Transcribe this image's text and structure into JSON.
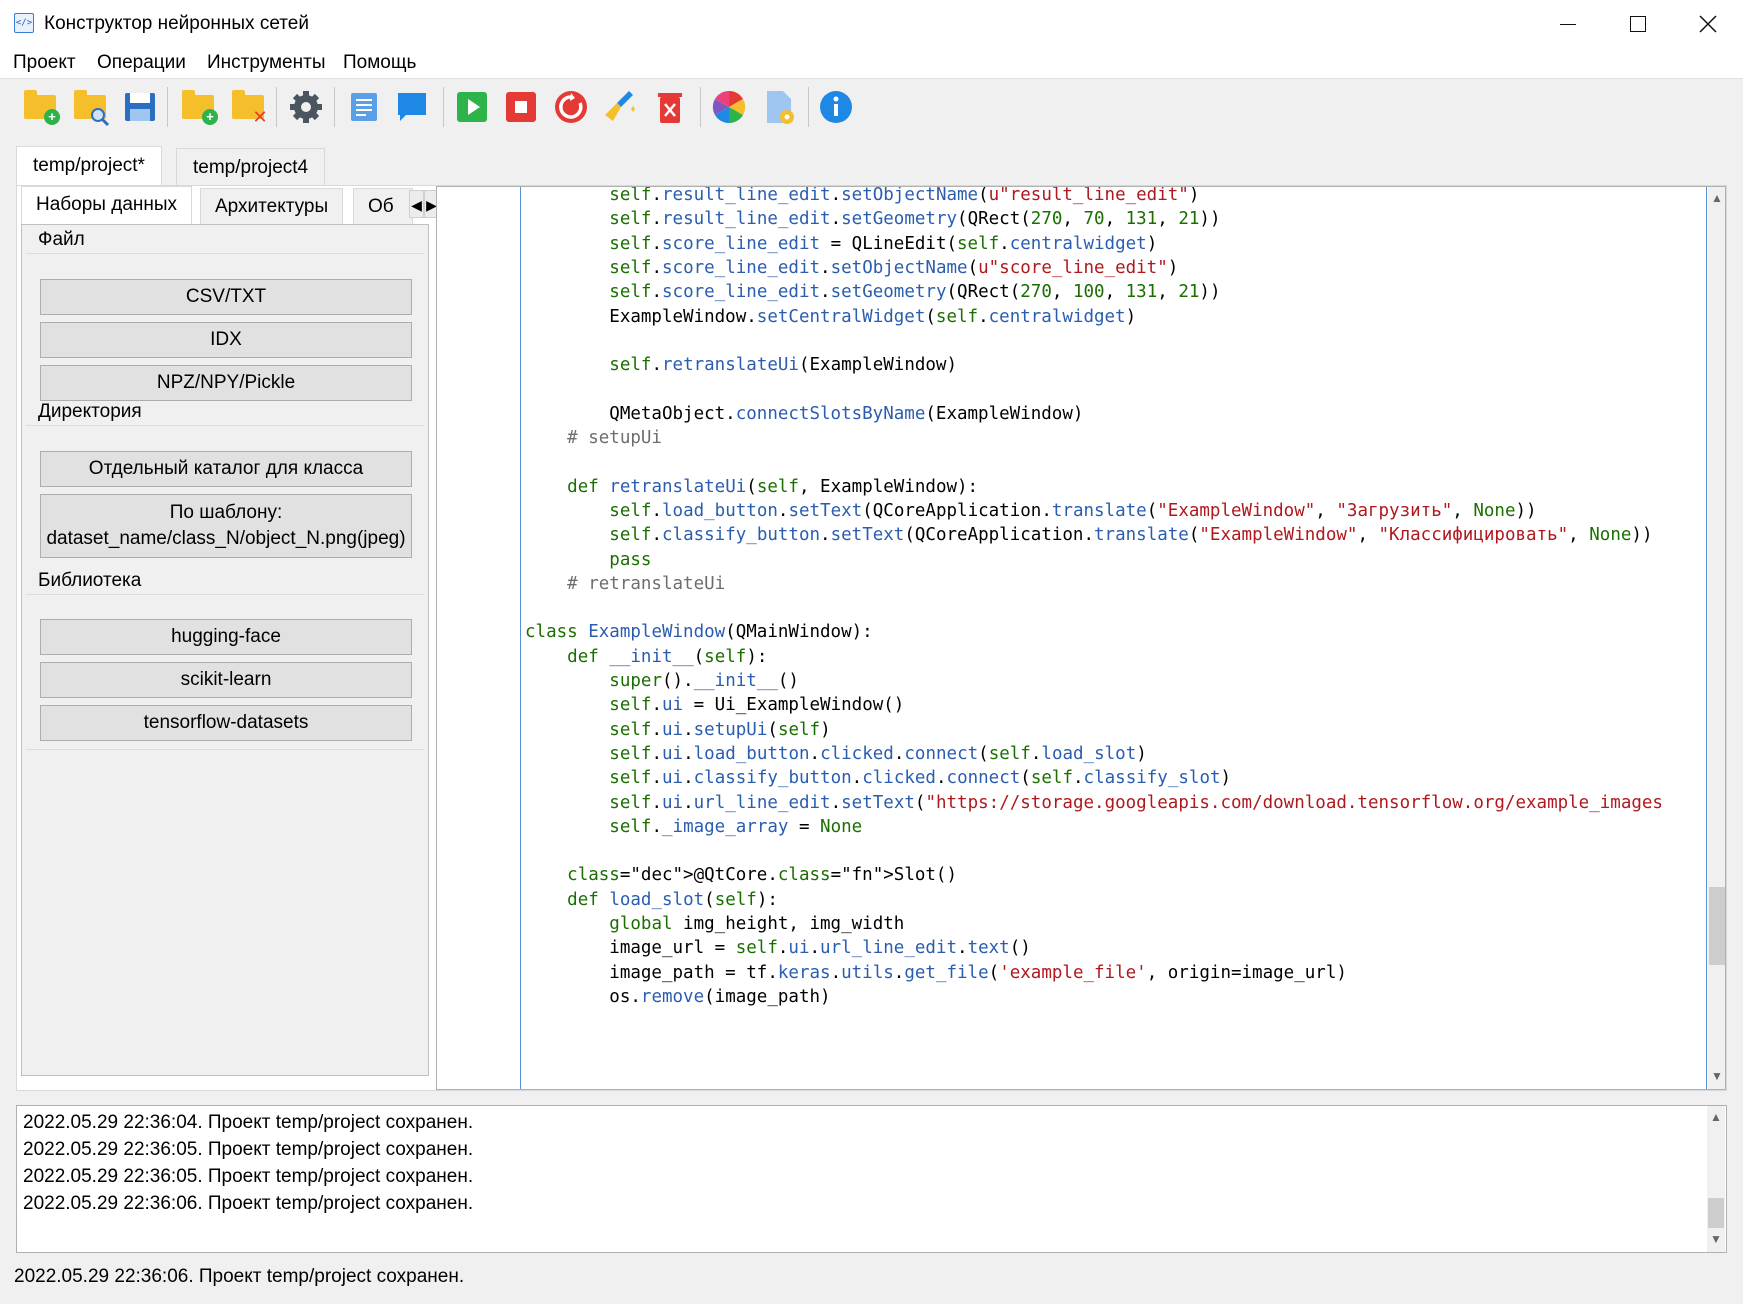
{
  "window": {
    "title": "Конструктор нейронных сетей",
    "icon_text": "</>"
  },
  "menu": [
    "Проект",
    "Операции",
    "Инструменты",
    "Помощь"
  ],
  "toolbar": {
    "icons": [
      "new-project-icon",
      "open-project-icon",
      "save-icon",
      "add-folder-icon",
      "remove-folder-icon",
      "settings-icon",
      "document-icon",
      "comment-icon",
      "run-icon",
      "stop-icon",
      "restart-icon",
      "clean-icon",
      "delete-icon",
      "color-palette-icon",
      "file-settings-icon",
      "info-icon"
    ],
    "colors": {
      "folder": "#f5bf2c",
      "save": "#2a6fc1",
      "run": "#2db34a",
      "stop": "#e53935",
      "info": "#1e88e5"
    }
  },
  "main_tabs": [
    "temp/project*",
    "temp/project4"
  ],
  "left_tabs": [
    "Наборы данных",
    "Архитектуры",
    "Об"
  ],
  "left_arrows": {
    "left": "◀",
    "right": "▶"
  },
  "datasets": {
    "file_group": "Файл",
    "file_buttons": [
      "CSV/TXT",
      "IDX",
      "NPZ/NPY/Pickle"
    ],
    "dir_group": "Директория",
    "dir_button_1": "Отдельный каталог для класса",
    "dir_button_2_line1": "По шаблону:",
    "dir_button_2_line2": "dataset_name/class_N/object_N.png(jpeg)",
    "lib_group": "Библиотека",
    "lib_buttons": [
      "hugging-face",
      "scikit-learn",
      "tensorflow-datasets"
    ]
  },
  "code_lines": [
    "        self.result_line_edit.setObjectName(u\"result_line_edit\")",
    "        self.result_line_edit.setGeometry(QRect(270, 70, 131, 21))",
    "        self.score_line_edit = QLineEdit(self.centralwidget)",
    "        self.score_line_edit.setObjectName(u\"score_line_edit\")",
    "        self.score_line_edit.setGeometry(QRect(270, 100, 131, 21))",
    "        ExampleWindow.setCentralWidget(self.centralwidget)",
    "",
    "        self.retranslateUi(ExampleWindow)",
    "",
    "        QMetaObject.connectSlotsByName(ExampleWindow)",
    "    # setupUi",
    "",
    "    def retranslateUi(self, ExampleWindow):",
    "        self.load_button.setText(QCoreApplication.translate(\"ExampleWindow\", \"Загрузить\", None))",
    "        self.classify_button.setText(QCoreApplication.translate(\"ExampleWindow\", \"Классифицировать\", None))",
    "        pass",
    "    # retranslateUi",
    "",
    "class ExampleWindow(QMainWindow):",
    "    def __init__(self):",
    "        super().__init__()",
    "        self.ui = Ui_ExampleWindow()",
    "        self.ui.setupUi(self)",
    "        self.ui.load_button.clicked.connect(self.load_slot)",
    "        self.ui.classify_button.clicked.connect(self.classify_slot)",
    "        self.ui.url_line_edit.setText(\"https://storage.googleapis.com/download.tensorflow.org/example_images",
    "        self._image_array = None",
    "",
    "    @QtCore.Slot()",
    "    def load_slot(self):",
    "        global img_height, img_width",
    "        image_url = self.ui.url_line_edit.text()",
    "        image_path = tf.keras.utils.get_file('example_file', origin=image_url)",
    "        os.remove(image_path)"
  ],
  "log": [
    "2022.05.29 22:36:04. Проект temp/project сохранен.",
    "2022.05.29 22:36:05. Проект temp/project сохранен.",
    "2022.05.29 22:36:05. Проект temp/project сохранен.",
    "2022.05.29 22:36:06. Проект temp/project сохранен."
  ],
  "scroll_glyphs": {
    "up": "▲",
    "down": "▼"
  },
  "status": "2022.05.29 22:36:06. Проект temp/project сохранен."
}
